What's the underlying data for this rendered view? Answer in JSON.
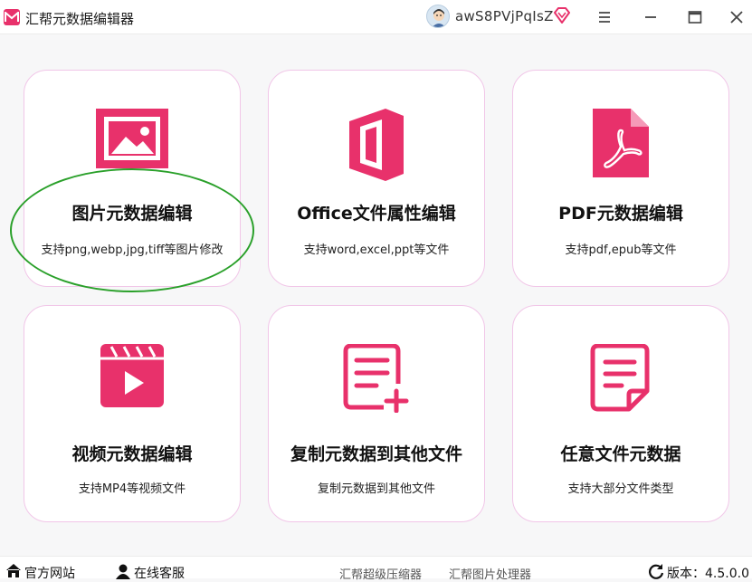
{
  "app": {
    "title": "汇帮元数据编辑器"
  },
  "user": {
    "name": "awS8PVjPqIsZ"
  },
  "icons": {
    "logo": "app-logo-icon",
    "avatar": "user-avatar",
    "vip": "diamond-vip-icon",
    "menu": "menu-icon",
    "minimize": "minimize-icon",
    "maximize": "maximize-icon",
    "close": "close-icon",
    "home": "home-icon",
    "service": "headset-icon",
    "refresh": "refresh-icon"
  },
  "colors": {
    "accent": "#e8316b",
    "card_border": "#f1c6e8",
    "highlight": "#2aa02a"
  },
  "cards": [
    {
      "title": "图片元数据编辑",
      "desc": "支持png,webp,jpg,tiff等图片修改",
      "icon": "image-icon"
    },
    {
      "title": "Office文件属性编辑",
      "desc": "支持word,excel,ppt等文件",
      "icon": "office-icon"
    },
    {
      "title": "PDF元数据编辑",
      "desc": "支持pdf,epub等文件",
      "icon": "pdf-icon"
    },
    {
      "title": "视频元数据编辑",
      "desc": "支持MP4等视频文件",
      "icon": "video-icon"
    },
    {
      "title": "复制元数据到其他文件",
      "desc": "复制元数据到其他文件",
      "icon": "copy-document-icon"
    },
    {
      "title": "任意文件元数据",
      "desc": "支持大部分文件类型",
      "icon": "document-icon"
    }
  ],
  "footer": {
    "website": "官方网站",
    "service": "在线客服",
    "link1": "汇帮超级压缩器",
    "link2": "汇帮图片处理器",
    "version_label": "版本：",
    "version": "4.5.0.0"
  }
}
